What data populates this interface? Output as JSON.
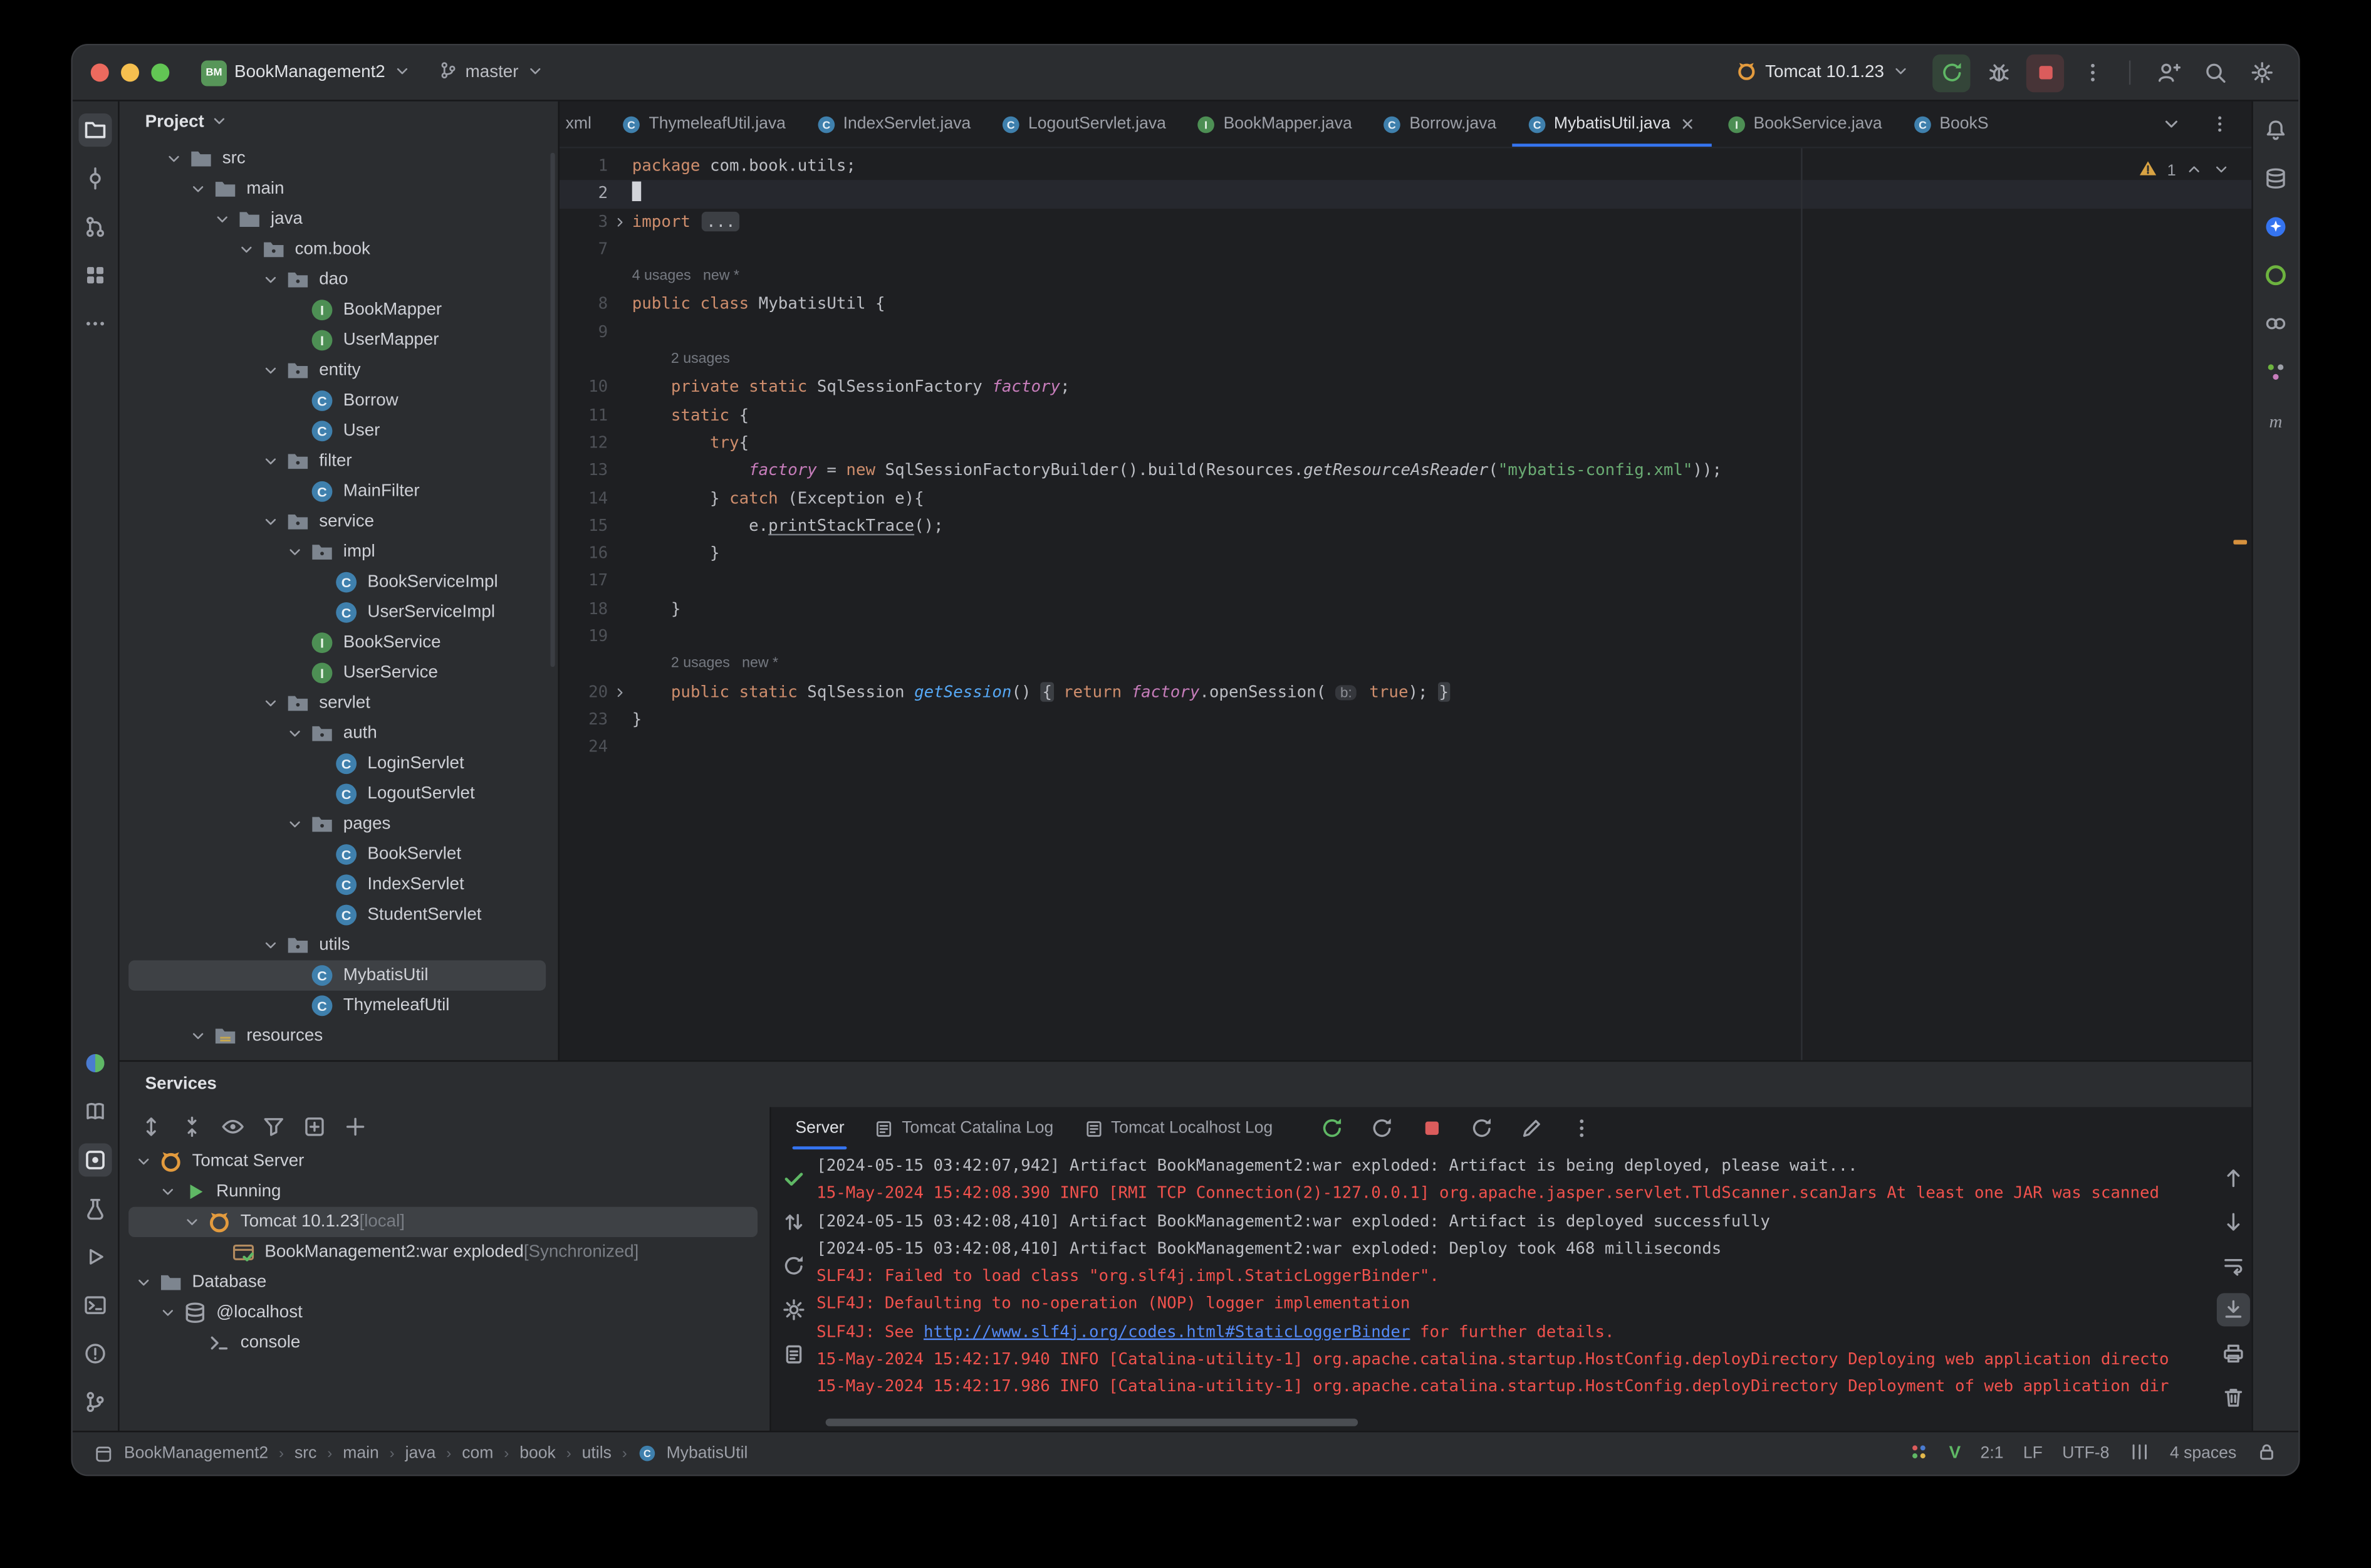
{
  "titlebar": {
    "logo_text": "BM",
    "project_name": "BookManagement2",
    "branch": "master",
    "run_config": "Tomcat 10.1.23",
    "traffic_lights": [
      "#ec6a5e",
      "#f5bf4f",
      "#62c554"
    ],
    "actions": [
      {
        "icon": "rerun",
        "name": "rerun-button",
        "bg": "green"
      },
      {
        "icon": "bug",
        "name": "debug-button"
      },
      {
        "icon": "stop",
        "name": "stop-button",
        "bg": "red"
      },
      {
        "icon": "more-v",
        "name": "run-more-button"
      }
    ],
    "icons": [
      {
        "icon": "user-plus",
        "name": "code-with-me-button"
      },
      {
        "icon": "search",
        "name": "search-everywhere-button"
      },
      {
        "icon": "gear",
        "name": "settings-button"
      }
    ]
  },
  "left_stripe": {
    "top": [
      {
        "icon": "folder-tool",
        "name": "project-tool-button",
        "active": true
      },
      {
        "icon": "commit",
        "name": "commit-tool-button"
      },
      {
        "icon": "pr",
        "name": "pull-requests-tool-button"
      },
      {
        "icon": "grid",
        "name": "plugins-tool-button"
      },
      {
        "icon": "more-h",
        "name": "more-tool-windows-button"
      }
    ],
    "bottom": [
      {
        "icon": "two-tone",
        "name": "gradle-tool-button"
      },
      {
        "icon": "book",
        "name": "documentation-tool-button"
      },
      {
        "icon": "services",
        "name": "services-tool-button",
        "active": true
      },
      {
        "icon": "flask",
        "name": "tests-tool-button"
      },
      {
        "icon": "play-outline",
        "name": "run-tool-button"
      },
      {
        "icon": "terminal",
        "name": "terminal-tool-button"
      },
      {
        "icon": "problems",
        "name": "problems-tool-button"
      },
      {
        "icon": "branch",
        "name": "version-control-tool-button"
      }
    ]
  },
  "right_stripe": [
    {
      "icon": "bell",
      "name": "notifications-button"
    },
    {
      "icon": "db",
      "name": "database-tool-button"
    },
    {
      "icon": "ai",
      "name": "ai-assistant-tool-button"
    },
    {
      "icon": "spring",
      "name": "spring-tool-button"
    },
    {
      "icon": "endpoints",
      "name": "endpoints-tool-button"
    },
    {
      "icon": "beans",
      "name": "beans-tool-button"
    },
    {
      "icon": "maven",
      "name": "maven-tool-button"
    }
  ],
  "project_pane": {
    "title": "Project",
    "tree": [
      {
        "l": 1,
        "chev": true,
        "icon": "folder",
        "label": "src"
      },
      {
        "l": 2,
        "chev": true,
        "icon": "folder",
        "label": "main"
      },
      {
        "l": 3,
        "chev": true,
        "icon": "folder",
        "label": "java"
      },
      {
        "l": 4,
        "chev": true,
        "icon": "package",
        "label": "com.book"
      },
      {
        "l": 5,
        "chev": true,
        "icon": "package",
        "label": "dao"
      },
      {
        "l": 6,
        "icon": "interface",
        "label": "BookMapper"
      },
      {
        "l": 6,
        "icon": "interface",
        "label": "UserMapper"
      },
      {
        "l": 5,
        "chev": true,
        "icon": "package",
        "label": "entity"
      },
      {
        "l": 6,
        "icon": "class",
        "label": "Borrow"
      },
      {
        "l": 6,
        "icon": "class",
        "label": "User"
      },
      {
        "l": 5,
        "chev": true,
        "icon": "package",
        "label": "filter"
      },
      {
        "l": 6,
        "icon": "class",
        "label": "MainFilter"
      },
      {
        "l": 5,
        "chev": true,
        "icon": "package",
        "label": "service"
      },
      {
        "l": 6,
        "chev": true,
        "icon": "package",
        "label": "impl"
      },
      {
        "l": 7,
        "icon": "class",
        "label": "BookServiceImpl"
      },
      {
        "l": 7,
        "icon": "class",
        "label": "UserServiceImpl"
      },
      {
        "l": 6,
        "icon": "interface",
        "label": "BookService"
      },
      {
        "l": 6,
        "icon": "interface",
        "label": "UserService"
      },
      {
        "l": 5,
        "chev": true,
        "icon": "package",
        "label": "servlet"
      },
      {
        "l": 6,
        "chev": true,
        "icon": "package",
        "label": "auth"
      },
      {
        "l": 7,
        "icon": "class",
        "label": "LoginServlet"
      },
      {
        "l": 7,
        "icon": "class",
        "label": "LogoutServlet"
      },
      {
        "l": 6,
        "chev": true,
        "icon": "package",
        "label": "pages"
      },
      {
        "l": 7,
        "icon": "class",
        "label": "BookServlet"
      },
      {
        "l": 7,
        "icon": "class",
        "label": "IndexServlet"
      },
      {
        "l": 7,
        "icon": "class",
        "label": "StudentServlet"
      },
      {
        "l": 5,
        "chev": true,
        "icon": "package",
        "label": "utils"
      },
      {
        "l": 6,
        "icon": "class",
        "label": "MybatisUtil",
        "selected": true
      },
      {
        "l": 6,
        "icon": "class",
        "label": "ThymeleafUtil"
      },
      {
        "l": 2,
        "chev": true,
        "icon": "folder-res",
        "label": "resources"
      }
    ]
  },
  "editor": {
    "tabs": [
      {
        "label": "xml",
        "partial": true
      },
      {
        "label": "ThymeleafUtil.java",
        "icon": "class"
      },
      {
        "label": "IndexServlet.java",
        "icon": "class"
      },
      {
        "label": "LogoutServlet.java",
        "icon": "class"
      },
      {
        "label": "BookMapper.java",
        "icon": "interface"
      },
      {
        "label": "Borrow.java",
        "icon": "class"
      },
      {
        "label": "MybatisUtil.java",
        "icon": "class",
        "active": true,
        "closable": true
      },
      {
        "label": "BookService.java",
        "icon": "interface"
      },
      {
        "label": "BookS",
        "icon": "class",
        "clipped": true
      }
    ],
    "tab_controls": [
      {
        "icon": "chev-down",
        "name": "hidden-tabs-button"
      },
      {
        "icon": "more-v",
        "name": "tab-list-button"
      }
    ],
    "inspection_count": "1",
    "lines": [
      {
        "num": "1",
        "parts": [
          [
            "kw",
            "package"
          ],
          [
            "pl",
            " com.book.utils;"
          ]
        ]
      },
      {
        "num": "2",
        "caret": true,
        "current": true,
        "parts": []
      },
      {
        "num": "3",
        "fold_arrow": true,
        "parts": [
          [
            "kw",
            "import"
          ],
          [
            "pl",
            " "
          ],
          [
            "fold",
            "..."
          ]
        ]
      },
      {
        "num": "7",
        "parts": []
      },
      {
        "inlay": "4 usages   new *",
        "indent": 0
      },
      {
        "num": "8",
        "parts": [
          [
            "kw",
            "public"
          ],
          [
            "pl",
            " "
          ],
          [
            "kw",
            "class"
          ],
          [
            "pl",
            " MybatisUtil {"
          ]
        ]
      },
      {
        "num": "9",
        "parts": []
      },
      {
        "inlay": "2 usages",
        "indent": 4
      },
      {
        "num": "10",
        "parts": [
          [
            "pl",
            "    "
          ],
          [
            "kw",
            "private"
          ],
          [
            "pl",
            " "
          ],
          [
            "kw",
            "static"
          ],
          [
            "pl",
            " SqlSessionFactory "
          ],
          [
            "field",
            "factory"
          ],
          [
            "pl",
            ";"
          ]
        ]
      },
      {
        "num": "11",
        "parts": [
          [
            "pl",
            "    "
          ],
          [
            "kw",
            "static"
          ],
          [
            "pl",
            " {"
          ]
        ]
      },
      {
        "num": "12",
        "parts": [
          [
            "pl",
            "        "
          ],
          [
            "kw",
            "try"
          ],
          [
            "pl",
            "{"
          ]
        ]
      },
      {
        "num": "13",
        "parts": [
          [
            "pl",
            "            "
          ],
          [
            "field",
            "factory"
          ],
          [
            "pl",
            " = "
          ],
          [
            "kw",
            "new"
          ],
          [
            "pl",
            " SqlSessionFactoryBuilder().build(Resources."
          ],
          [
            "smeth",
            "getResourceAsReader"
          ],
          [
            "pl",
            "("
          ],
          [
            "str",
            "\"mybatis-config.xml\""
          ],
          [
            "pl",
            "));"
          ]
        ]
      },
      {
        "num": "14",
        "parts": [
          [
            "pl",
            "        } "
          ],
          [
            "kw",
            "catch"
          ],
          [
            "pl",
            " (Exception e){"
          ]
        ]
      },
      {
        "num": "15",
        "parts": [
          [
            "pl",
            "            e."
          ],
          [
            "ul",
            "printStackTrace"
          ],
          [
            "pl",
            "();"
          ]
        ]
      },
      {
        "num": "16",
        "parts": [
          [
            "pl",
            "        }"
          ]
        ]
      },
      {
        "num": "17",
        "parts": []
      },
      {
        "num": "18",
        "parts": [
          [
            "pl",
            "    }"
          ]
        ]
      },
      {
        "num": "19",
        "parts": []
      },
      {
        "inlay": "2 usages   new *",
        "indent": 4
      },
      {
        "num": "20",
        "fold_arrow": true,
        "parts": [
          [
            "pl",
            "    "
          ],
          [
            "kw",
            "public"
          ],
          [
            "pl",
            " "
          ],
          [
            "kw",
            "static"
          ],
          [
            "pl",
            " SqlSession "
          ],
          [
            "meth",
            "getSession"
          ],
          [
            "pl",
            "() "
          ],
          [
            "foldb",
            "{"
          ],
          [
            "pl",
            " "
          ],
          [
            "kw",
            "return"
          ],
          [
            "pl",
            " "
          ],
          [
            "field",
            "factory"
          ],
          [
            "pl",
            ".openSession( "
          ],
          [
            "hint",
            "b:"
          ],
          [
            "pl",
            " "
          ],
          [
            "kw",
            "true"
          ],
          [
            "pl",
            "); "
          ],
          [
            "foldb",
            "}"
          ]
        ]
      },
      {
        "num": "23",
        "parts": [
          [
            "pl",
            "}"
          ]
        ]
      },
      {
        "num": "24",
        "parts": []
      }
    ]
  },
  "services": {
    "title": "Services",
    "toolbar": [
      {
        "icon": "expand",
        "name": "expand-all-button"
      },
      {
        "icon": "collapse",
        "name": "collapse-all-button"
      },
      {
        "icon": "eye",
        "name": "view-options-button"
      },
      {
        "icon": "funnel",
        "name": "filter-button"
      },
      {
        "icon": "add-box",
        "name": "add-service-button"
      },
      {
        "icon": "plus",
        "name": "add-button"
      }
    ],
    "tree": [
      {
        "l": 0,
        "chev": true,
        "icon": "tomcat",
        "label": "Tomcat Server"
      },
      {
        "l": 1,
        "chev": true,
        "icon": "run",
        "label": "Running"
      },
      {
        "l": 2,
        "chev": true,
        "icon": "tomcat",
        "label": "Tomcat 10.1.23",
        "suffix": " [local]",
        "selected": true
      },
      {
        "l": 3,
        "icon": "artifact",
        "label": "BookManagement2:war exploded",
        "suffix": " [Synchronized]"
      },
      {
        "l": 0,
        "chev": true,
        "icon": "folder",
        "label": "Database"
      },
      {
        "l": 1,
        "chev": true,
        "icon": "db",
        "label": "@localhost"
      },
      {
        "l": 2,
        "icon": "console-i",
        "label": "console"
      }
    ]
  },
  "console": {
    "tabs": [
      {
        "label": "Server",
        "active": true
      },
      {
        "label": "Tomcat Catalina Log",
        "icon": "log"
      },
      {
        "label": "Tomcat Localhost Log",
        "icon": "log"
      }
    ],
    "actions": [
      {
        "icon": "rerun",
        "name": "rerun-server-button"
      },
      {
        "icon": "refresh",
        "name": "redeploy-button"
      },
      {
        "icon": "stop",
        "name": "stop-server-button"
      },
      {
        "icon": "refresh",
        "name": "update-application-button"
      },
      {
        "icon": "pencil",
        "name": "edit-configuration-button"
      },
      {
        "icon": "more-v",
        "name": "console-more-button"
      }
    ],
    "left_icons": [
      {
        "icon": "check",
        "name": "deploy-status-icon"
      },
      {
        "icon": "updown",
        "name": "reorder-icon"
      },
      {
        "icon": "refresh",
        "name": "refresh-icon"
      },
      {
        "icon": "gear",
        "name": "console-settings-icon"
      },
      {
        "icon": "clipboard",
        "name": "clipboard-icon"
      }
    ],
    "right_icons": [
      {
        "icon": "arrow-up",
        "name": "scroll-up-button"
      },
      {
        "icon": "arrow-down",
        "name": "scroll-down-button"
      },
      {
        "icon": "softwrap",
        "name": "soft-wrap-button"
      },
      {
        "icon": "scrollend",
        "name": "scroll-to-end-button",
        "active": true
      },
      {
        "icon": "print",
        "name": "print-button"
      },
      {
        "icon": "trash",
        "name": "clear-console-button"
      }
    ],
    "lines": [
      {
        "s": "info",
        "t": "[2024-05-15 03:42:07,942] Artifact BookManagement2:war exploded: Artifact is being deployed, please wait..."
      },
      {
        "s": "err",
        "t": "15-May-2024 15:42:08.390 INFO [RMI TCP Connection(2)-127.0.0.1] org.apache.jasper.servlet.TldScanner.scanJars At least one JAR was scanned"
      },
      {
        "s": "info",
        "t": "[2024-05-15 03:42:08,410] Artifact BookManagement2:war exploded: Artifact is deployed successfully"
      },
      {
        "s": "info",
        "t": "[2024-05-15 03:42:08,410] Artifact BookManagement2:war exploded: Deploy took 468 milliseconds"
      },
      {
        "s": "err",
        "t": "SLF4J: Failed to load class \"org.slf4j.impl.StaticLoggerBinder\"."
      },
      {
        "s": "err",
        "t": "SLF4J: Defaulting to no-operation (NOP) logger implementation"
      },
      {
        "s": "err",
        "t": "SLF4J: See ",
        "link": "http://www.slf4j.org/codes.html#StaticLoggerBinder",
        "t2": " for further details."
      },
      {
        "s": "err",
        "t": "15-May-2024 15:42:17.940 INFO [Catalina-utility-1] org.apache.catalina.startup.HostConfig.deployDirectory Deploying web application directo"
      },
      {
        "s": "err",
        "t": "15-May-2024 15:42:17.986 INFO [Catalina-utility-1] org.apache.catalina.startup.HostConfig.deployDirectory Deployment of web application dir"
      }
    ]
  },
  "statusbar": {
    "crumbs": [
      "BookManagement2",
      "src",
      "main",
      "java",
      "com",
      "book",
      "utils",
      "MybatisUtil"
    ],
    "caret_pos": "2:1",
    "line_ending": "LF",
    "encoding": "UTF-8",
    "indent": "4 spaces",
    "widgets": [
      {
        "type": "icon",
        "icon": "plugin-dots",
        "name": "plugin-widget-icon"
      },
      {
        "type": "vim",
        "name": "ideavim-widget",
        "label": "V"
      },
      {
        "type": "text",
        "key": "caret_pos",
        "name": "caret-position-widget"
      },
      {
        "type": "text",
        "key": "line_ending",
        "name": "line-separator-widget"
      },
      {
        "type": "text",
        "key": "encoding",
        "name": "encoding-widget"
      },
      {
        "type": "icon",
        "icon": "vbars",
        "name": "indent-widget-icon"
      },
      {
        "type": "text",
        "key": "indent",
        "name": "indent-widget"
      },
      {
        "type": "icon",
        "icon": "lock",
        "name": "readonly-widget-icon"
      }
    ]
  }
}
